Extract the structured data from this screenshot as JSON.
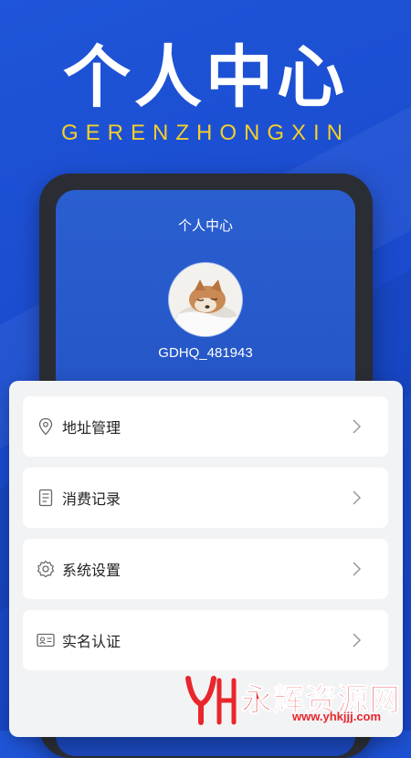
{
  "hero": {
    "title": "个人中心",
    "subtitle": "GERENZHONGXIN"
  },
  "screen": {
    "title": "个人中心",
    "username": "GDHQ_481943",
    "avatar_icon": "dog-avatar"
  },
  "menu": [
    {
      "label": "地址管理",
      "icon": "location-pin-icon"
    },
    {
      "label": "消费记录",
      "icon": "receipt-icon"
    },
    {
      "label": "系统设置",
      "icon": "gear-icon"
    },
    {
      "label": "实名认证",
      "icon": "id-card-icon"
    }
  ],
  "watermark": {
    "text": "永辉资源网",
    "url": "www.yhkjjj.com"
  },
  "colors": {
    "background": "#1f55d8",
    "subtitle": "#f4cf2b",
    "watermark": "#e8262c"
  }
}
